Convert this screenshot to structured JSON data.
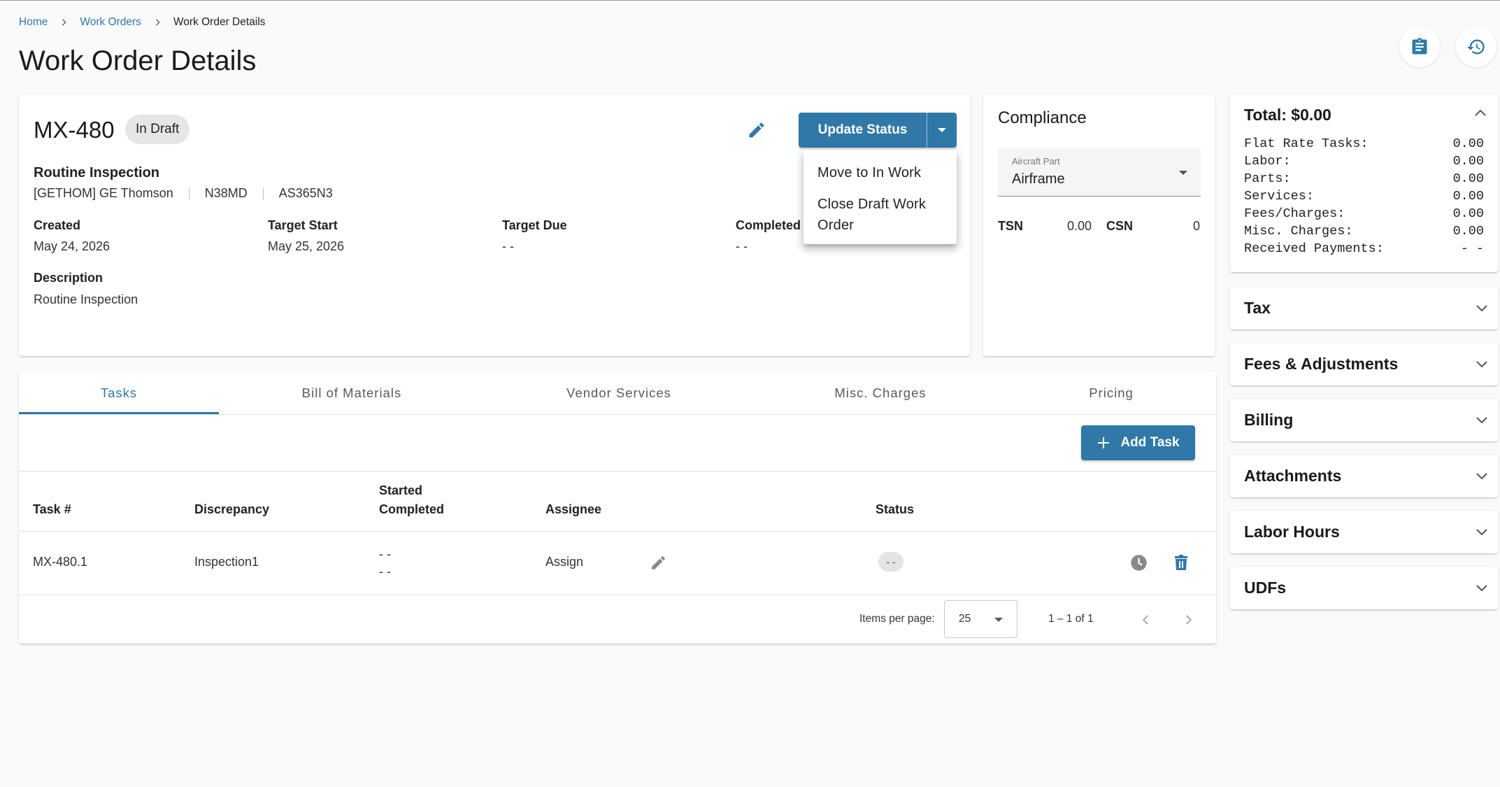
{
  "breadcrumb": {
    "items": [
      {
        "label": "Home"
      },
      {
        "label": "Work Orders"
      },
      {
        "label": "Work Order Details"
      }
    ]
  },
  "page": {
    "title": "Work Order Details"
  },
  "header_icons": {
    "notes_icon": "clipboard-icon",
    "history_icon": "history-icon"
  },
  "work_order": {
    "number": "MX-480",
    "status_badge": "In Draft",
    "update_status_label": "Update Status",
    "subject": "Routine Inspection",
    "customer": "[GETHOM] GE Thomson",
    "registration": "N38MD",
    "model": "AS365N3",
    "dates": {
      "created_label": "Created",
      "created_value": "May 24, 2026",
      "target_start_label": "Target Start",
      "target_start_value": "May 25, 2026",
      "target_due_label": "Target Due",
      "target_due_value": "- -",
      "completed_label": "Completed",
      "completed_value": "- -"
    },
    "description_label": "Description",
    "description_value": "Routine Inspection"
  },
  "status_menu": {
    "items": [
      {
        "label": "Move to In Work"
      },
      {
        "label": "Close Draft Work Order"
      }
    ]
  },
  "compliance": {
    "title": "Compliance",
    "aircraft_part_label": "Aircraft Part",
    "aircraft_part_value": "Airframe",
    "tsn_label": "TSN",
    "tsn_value": "0.00",
    "csn_label": "CSN",
    "csn_value": "0"
  },
  "tabs": [
    {
      "label": "Tasks",
      "active": true
    },
    {
      "label": "Bill of Materials",
      "active": false
    },
    {
      "label": "Vendor Services",
      "active": false
    },
    {
      "label": "Misc. Charges",
      "active": false
    },
    {
      "label": "Pricing",
      "active": false
    }
  ],
  "tasks": {
    "add_task_label": "Add Task",
    "columns": {
      "task_no": "Task #",
      "discrepancy": "Discrepancy",
      "started": "Started",
      "completed": "Completed",
      "assignee": "Assignee",
      "status": "Status"
    },
    "rows": [
      {
        "task_no": "MX-480.1",
        "discrepancy": "Inspection1",
        "started": "- -",
        "completed": "- -",
        "assignee": "Assign",
        "status": "- -"
      }
    ],
    "paginator": {
      "items_per_page_label": "Items per page:",
      "page_size": "25",
      "range": "1 – 1 of 1"
    }
  },
  "totals": {
    "title": "Total: $0.00",
    "rows": [
      {
        "label": "Flat Rate Tasks:",
        "value": "0.00"
      },
      {
        "label": "Labor:",
        "value": "0.00"
      },
      {
        "label": "Parts:",
        "value": "0.00"
      },
      {
        "label": "Services:",
        "value": "0.00"
      },
      {
        "label": "Fees/Charges:",
        "value": "0.00"
      },
      {
        "label": "Misc. Charges:",
        "value": "0.00"
      },
      {
        "label": "Received Payments:",
        "value": "- -"
      }
    ]
  },
  "panels": [
    {
      "label": "Tax"
    },
    {
      "label": "Fees & Adjustments"
    },
    {
      "label": "Billing"
    },
    {
      "label": "Attachments"
    },
    {
      "label": "Labor Hours"
    },
    {
      "label": "UDFs"
    }
  ],
  "colors": {
    "accent": "#2f78a8",
    "page_bg": "#fafafa",
    "chip_bg": "#e6e6e6"
  }
}
